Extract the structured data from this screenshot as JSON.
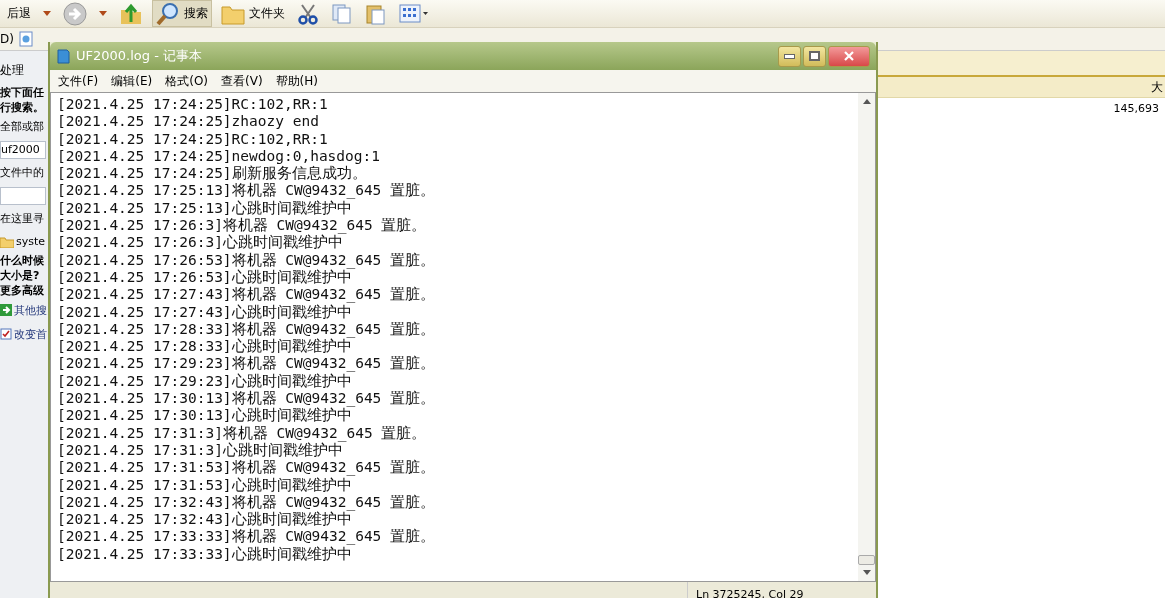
{
  "explorer": {
    "toolbar": [
      {
        "kind": "text",
        "label": "后退",
        "selected": false
      },
      {
        "kind": "caret",
        "selected": false
      },
      {
        "kind": "forward",
        "selected": false
      },
      {
        "kind": "caret",
        "selected": false
      },
      {
        "kind": "up",
        "selected": false
      },
      {
        "kind": "search",
        "label": "搜索",
        "selected": true
      },
      {
        "kind": "folders",
        "label": "文件夹",
        "selected": false
      },
      {
        "kind": "cut",
        "selected": false
      },
      {
        "kind": "copy",
        "selected": false
      },
      {
        "kind": "paste",
        "selected": false
      },
      {
        "kind": "views",
        "selected": false
      }
    ],
    "address_label": "D)",
    "left_panel": [
      {
        "kind": "heading",
        "text": "处理"
      },
      {
        "kind": "bold",
        "text": "按下面任"
      },
      {
        "kind": "bold",
        "text": "行搜索。"
      },
      {
        "kind": "text",
        "text": "全部或部"
      },
      {
        "kind": "field",
        "text": "uf2000"
      },
      {
        "kind": "text",
        "text": "文件中的"
      },
      {
        "kind": "blank"
      },
      {
        "kind": "text",
        "text": "在这里寻"
      },
      {
        "kind": "folder",
        "text": "syste"
      },
      {
        "kind": "bold",
        "text": "什么时候"
      },
      {
        "kind": "bold",
        "text": "大小是?"
      },
      {
        "kind": "bold",
        "text": "更多高级"
      },
      {
        "kind": "arrowlink",
        "text": "其他搜"
      },
      {
        "kind": "checklink",
        "text": "改变首"
      }
    ],
    "column_header": "大",
    "row_value": "145,693"
  },
  "notepad": {
    "title": "UF2000.log - 记事本",
    "menu": [
      "文件(F)",
      "编辑(E)",
      "格式(O)",
      "查看(V)",
      "帮助(H)"
    ],
    "lines": [
      "[2021.4.25 17:24:25]RC:102,RR:1",
      "[2021.4.25 17:24:25]zhaozy end",
      "[2021.4.25 17:24:25]RC:102,RR:1",
      "[2021.4.25 17:24:25]newdog:0,hasdog:1",
      "[2021.4.25 17:24:25]刷新服务信息成功。",
      "[2021.4.25 17:25:13]将机器 CW@9432_645 置脏。",
      "[2021.4.25 17:25:13]心跳时间戳维护中",
      "[2021.4.25 17:26:3]将机器 CW@9432_645 置脏。",
      "[2021.4.25 17:26:3]心跳时间戳维护中",
      "[2021.4.25 17:26:53]将机器 CW@9432_645 置脏。",
      "[2021.4.25 17:26:53]心跳时间戳维护中",
      "[2021.4.25 17:27:43]将机器 CW@9432_645 置脏。",
      "[2021.4.25 17:27:43]心跳时间戳维护中",
      "[2021.4.25 17:28:33]将机器 CW@9432_645 置脏。",
      "[2021.4.25 17:28:33]心跳时间戳维护中",
      "[2021.4.25 17:29:23]将机器 CW@9432_645 置脏。",
      "[2021.4.25 17:29:23]心跳时间戳维护中",
      "[2021.4.25 17:30:13]将机器 CW@9432_645 置脏。",
      "[2021.4.25 17:30:13]心跳时间戳维护中",
      "[2021.4.25 17:31:3]将机器 CW@9432_645 置脏。",
      "[2021.4.25 17:31:3]心跳时间戳维护中",
      "[2021.4.25 17:31:53]将机器 CW@9432_645 置脏。",
      "[2021.4.25 17:31:53]心跳时间戳维护中",
      "[2021.4.25 17:32:43]将机器 CW@9432_645 置脏。",
      "[2021.4.25 17:32:43]心跳时间戳维护中",
      "[2021.4.25 17:33:33]将机器 CW@9432_645 置脏。",
      "[2021.4.25 17:33:33]心跳时间戳维护中"
    ],
    "status": "Ln 3725245, Col 29"
  }
}
